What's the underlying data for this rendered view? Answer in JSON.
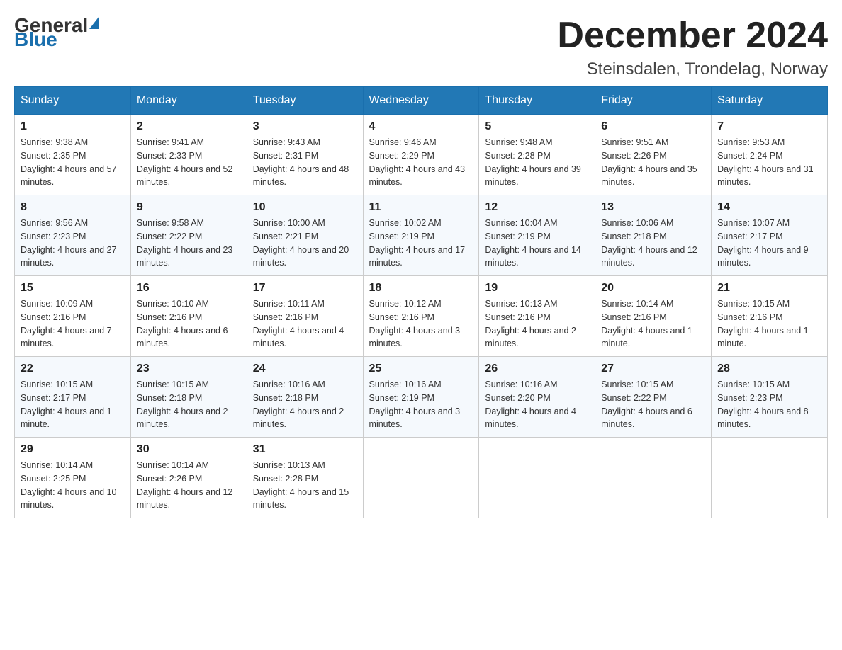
{
  "logo": {
    "general": "General",
    "blue": "Blue"
  },
  "header": {
    "month": "December 2024",
    "location": "Steinsdalen, Trondelag, Norway"
  },
  "weekdays": [
    "Sunday",
    "Monday",
    "Tuesday",
    "Wednesday",
    "Thursday",
    "Friday",
    "Saturday"
  ],
  "weeks": [
    [
      {
        "day": 1,
        "sunrise": "9:38 AM",
        "sunset": "2:35 PM",
        "daylight": "4 hours and 57 minutes."
      },
      {
        "day": 2,
        "sunrise": "9:41 AM",
        "sunset": "2:33 PM",
        "daylight": "4 hours and 52 minutes."
      },
      {
        "day": 3,
        "sunrise": "9:43 AM",
        "sunset": "2:31 PM",
        "daylight": "4 hours and 48 minutes."
      },
      {
        "day": 4,
        "sunrise": "9:46 AM",
        "sunset": "2:29 PM",
        "daylight": "4 hours and 43 minutes."
      },
      {
        "day": 5,
        "sunrise": "9:48 AM",
        "sunset": "2:28 PM",
        "daylight": "4 hours and 39 minutes."
      },
      {
        "day": 6,
        "sunrise": "9:51 AM",
        "sunset": "2:26 PM",
        "daylight": "4 hours and 35 minutes."
      },
      {
        "day": 7,
        "sunrise": "9:53 AM",
        "sunset": "2:24 PM",
        "daylight": "4 hours and 31 minutes."
      }
    ],
    [
      {
        "day": 8,
        "sunrise": "9:56 AM",
        "sunset": "2:23 PM",
        "daylight": "4 hours and 27 minutes."
      },
      {
        "day": 9,
        "sunrise": "9:58 AM",
        "sunset": "2:22 PM",
        "daylight": "4 hours and 23 minutes."
      },
      {
        "day": 10,
        "sunrise": "10:00 AM",
        "sunset": "2:21 PM",
        "daylight": "4 hours and 20 minutes."
      },
      {
        "day": 11,
        "sunrise": "10:02 AM",
        "sunset": "2:19 PM",
        "daylight": "4 hours and 17 minutes."
      },
      {
        "day": 12,
        "sunrise": "10:04 AM",
        "sunset": "2:19 PM",
        "daylight": "4 hours and 14 minutes."
      },
      {
        "day": 13,
        "sunrise": "10:06 AM",
        "sunset": "2:18 PM",
        "daylight": "4 hours and 12 minutes."
      },
      {
        "day": 14,
        "sunrise": "10:07 AM",
        "sunset": "2:17 PM",
        "daylight": "4 hours and 9 minutes."
      }
    ],
    [
      {
        "day": 15,
        "sunrise": "10:09 AM",
        "sunset": "2:16 PM",
        "daylight": "4 hours and 7 minutes."
      },
      {
        "day": 16,
        "sunrise": "10:10 AM",
        "sunset": "2:16 PM",
        "daylight": "4 hours and 6 minutes."
      },
      {
        "day": 17,
        "sunrise": "10:11 AM",
        "sunset": "2:16 PM",
        "daylight": "4 hours and 4 minutes."
      },
      {
        "day": 18,
        "sunrise": "10:12 AM",
        "sunset": "2:16 PM",
        "daylight": "4 hours and 3 minutes."
      },
      {
        "day": 19,
        "sunrise": "10:13 AM",
        "sunset": "2:16 PM",
        "daylight": "4 hours and 2 minutes."
      },
      {
        "day": 20,
        "sunrise": "10:14 AM",
        "sunset": "2:16 PM",
        "daylight": "4 hours and 1 minute."
      },
      {
        "day": 21,
        "sunrise": "10:15 AM",
        "sunset": "2:16 PM",
        "daylight": "4 hours and 1 minute."
      }
    ],
    [
      {
        "day": 22,
        "sunrise": "10:15 AM",
        "sunset": "2:17 PM",
        "daylight": "4 hours and 1 minute."
      },
      {
        "day": 23,
        "sunrise": "10:15 AM",
        "sunset": "2:18 PM",
        "daylight": "4 hours and 2 minutes."
      },
      {
        "day": 24,
        "sunrise": "10:16 AM",
        "sunset": "2:18 PM",
        "daylight": "4 hours and 2 minutes."
      },
      {
        "day": 25,
        "sunrise": "10:16 AM",
        "sunset": "2:19 PM",
        "daylight": "4 hours and 3 minutes."
      },
      {
        "day": 26,
        "sunrise": "10:16 AM",
        "sunset": "2:20 PM",
        "daylight": "4 hours and 4 minutes."
      },
      {
        "day": 27,
        "sunrise": "10:15 AM",
        "sunset": "2:22 PM",
        "daylight": "4 hours and 6 minutes."
      },
      {
        "day": 28,
        "sunrise": "10:15 AM",
        "sunset": "2:23 PM",
        "daylight": "4 hours and 8 minutes."
      }
    ],
    [
      {
        "day": 29,
        "sunrise": "10:14 AM",
        "sunset": "2:25 PM",
        "daylight": "4 hours and 10 minutes."
      },
      {
        "day": 30,
        "sunrise": "10:14 AM",
        "sunset": "2:26 PM",
        "daylight": "4 hours and 12 minutes."
      },
      {
        "day": 31,
        "sunrise": "10:13 AM",
        "sunset": "2:28 PM",
        "daylight": "4 hours and 15 minutes."
      },
      null,
      null,
      null,
      null
    ]
  ]
}
